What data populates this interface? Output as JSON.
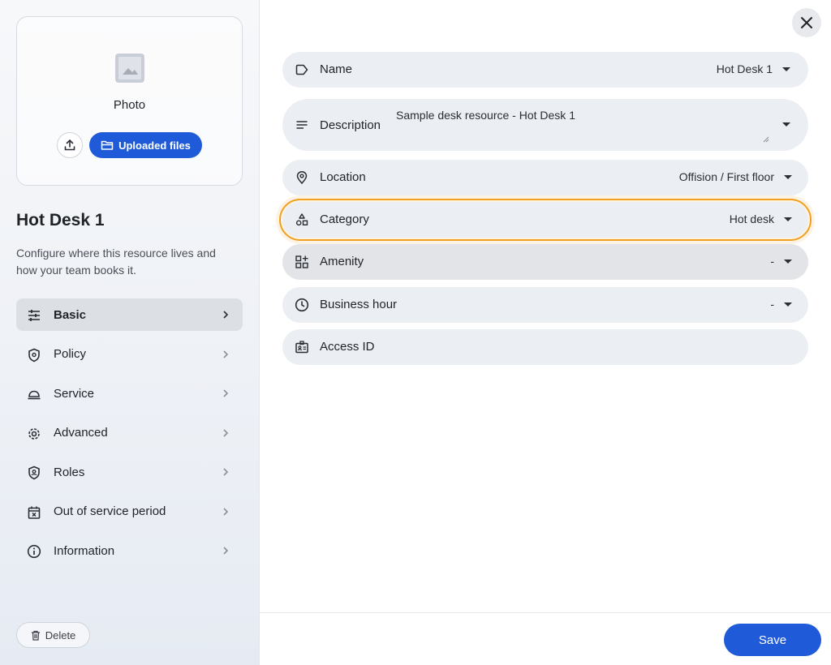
{
  "sidebar": {
    "photo_label": "Photo",
    "uploaded_files_label": "Uploaded files",
    "resource_title": "Hot Desk 1",
    "resource_description": "Configure where this resource lives and how your team books it.",
    "nav_items": [
      {
        "label": "Basic",
        "icon": "sliders-icon",
        "active": true
      },
      {
        "label": "Policy",
        "icon": "shield-icon"
      },
      {
        "label": "Service",
        "icon": "service-bell-icon"
      },
      {
        "label": "Advanced",
        "icon": "gear-icon"
      },
      {
        "label": "Roles",
        "icon": "shield-user-icon"
      },
      {
        "label": "Out of service period",
        "icon": "calendar-x-icon"
      },
      {
        "label": "Information",
        "icon": "info-icon"
      }
    ],
    "delete_label": "Delete"
  },
  "form": {
    "fields": [
      {
        "label": "Name",
        "value": "Hot Desk 1",
        "icon": "tag-icon"
      },
      {
        "label": "Description",
        "value": "Sample desk resource - Hot Desk 1",
        "icon": "lines-icon"
      },
      {
        "label": "Location",
        "value": "Offision / First floor",
        "icon": "location-pin-icon"
      },
      {
        "label": "Category",
        "value": "Hot desk",
        "icon": "shapes-icon"
      },
      {
        "label": "Amenity",
        "value": "-",
        "icon": "grid-plus-icon"
      },
      {
        "label": "Business hour",
        "value": "-",
        "icon": "clock-icon"
      },
      {
        "label": "Access ID",
        "value": "",
        "icon": "id-badge-icon"
      }
    ],
    "save_label": "Save"
  },
  "colors": {
    "primary": "#1f5bd8",
    "focus_outline": "#f0a020",
    "field_bg": "#ebeef2"
  }
}
